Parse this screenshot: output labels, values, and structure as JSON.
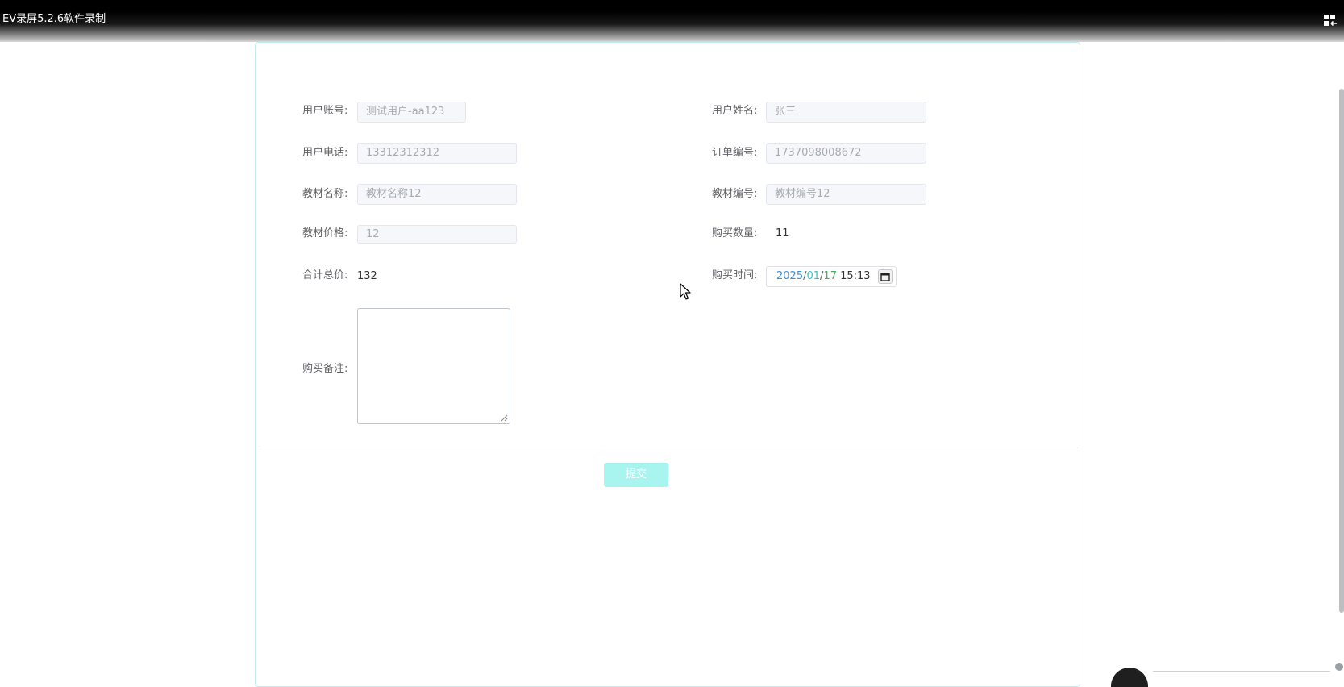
{
  "window": {
    "title": "EV录屏5.2.6软件录制"
  },
  "form": {
    "user_account": {
      "label": "用户账号:",
      "value": "测试用户-aa123"
    },
    "user_name": {
      "label": "用户姓名:",
      "value": "张三"
    },
    "user_phone": {
      "label": "用户电话:",
      "value": "13312312312"
    },
    "order_no": {
      "label": "订单编号:",
      "value": "1737098008672"
    },
    "book_name": {
      "label": "教材名称:",
      "value": "教材名称12"
    },
    "book_no": {
      "label": "教材编号:",
      "value": "教材编号12"
    },
    "book_price": {
      "label": "教材价格:",
      "value": "12"
    },
    "buy_qty": {
      "label": "购买数量:",
      "value": "11"
    },
    "total": {
      "label": "合计总价:",
      "value": "132"
    },
    "buy_time": {
      "label": "购买时间:",
      "year": "2025",
      "sep": "/",
      "month": "01",
      "day": "17",
      "time": "15:13"
    },
    "remark": {
      "label": "购买备注:",
      "value": ""
    },
    "submit_label": "提交"
  },
  "colors": {
    "panel_border": "#bdeff0",
    "submit_bg": "#a8f4ef",
    "year": "#3d8fd6",
    "month": "#38c1c6",
    "day": "#3fae5a"
  },
  "icons": {
    "fullscreen": "fullscreen-exit-icon",
    "calendar": "calendar-icon",
    "cursor": "mouse-cursor-icon"
  }
}
